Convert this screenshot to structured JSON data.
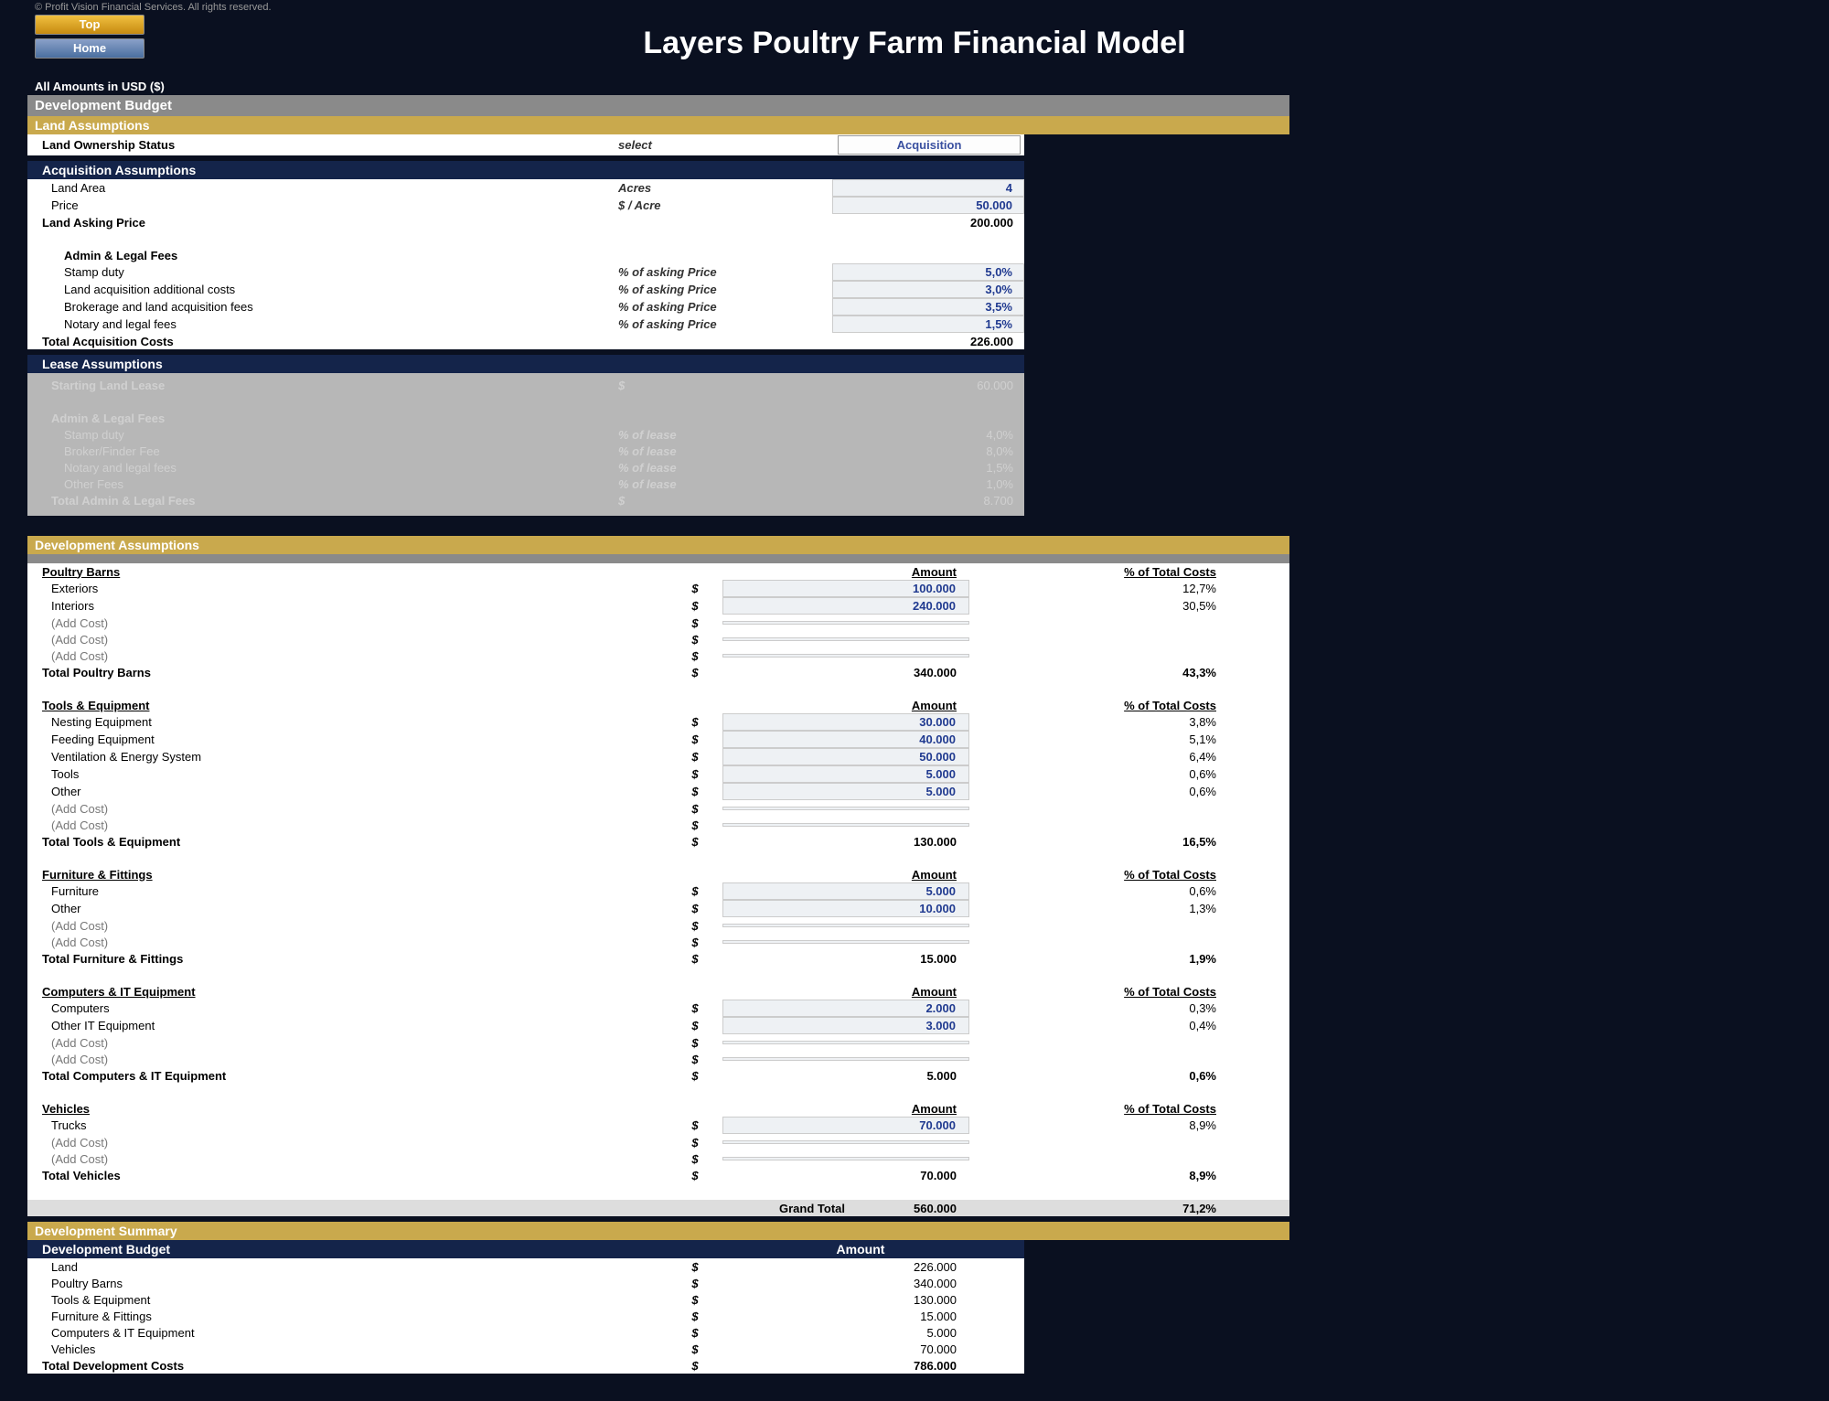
{
  "copyright": "© Profit Vision Financial Services. All rights reserved.",
  "buttons": {
    "top": "Top",
    "home": "Home"
  },
  "title": "Layers Poultry Farm Financial Model",
  "currency_note": "All Amounts in  USD ($)",
  "headers": {
    "development_budget": "Development Budget",
    "land_assumptions": "Land Assumptions",
    "acquisition_assumptions": "Acquisition Assumptions",
    "lease_assumptions": "Lease Assumptions",
    "development_assumptions": "Development Assumptions",
    "development_summary": "Development Summary",
    "development_budget2": "Development Budget"
  },
  "land_ownership": {
    "label": "Land Ownership Status",
    "unit": "select",
    "value": "Acquisition"
  },
  "acq": {
    "area": {
      "label": "Land Area",
      "unit": "Acres",
      "value": "4"
    },
    "price": {
      "label": "Price",
      "unit": "$ / Acre",
      "value": "50.000"
    },
    "asking": {
      "label": "Land Asking Price",
      "value": "200.000"
    },
    "fees_header": "Admin & Legal Fees",
    "fees": [
      {
        "label": "Stamp duty",
        "unit": "% of asking Price",
        "value": "5,0%"
      },
      {
        "label": "Land acquisition additional costs",
        "unit": "% of asking Price",
        "value": "3,0%"
      },
      {
        "label": "Brokerage and land acquisition fees",
        "unit": "% of asking Price",
        "value": "3,5%"
      },
      {
        "label": "Notary and legal fees",
        "unit": "% of asking Price",
        "value": "1,5%"
      }
    ],
    "total": {
      "label": "Total Acquisition Costs",
      "value": "226.000"
    }
  },
  "lease": {
    "start": {
      "label": "Starting Land Lease",
      "unit": "$",
      "value": "60.000"
    },
    "fees_header": "Admin & Legal Fees",
    "fees": [
      {
        "label": "Stamp duty",
        "unit": "% of lease",
        "value": "4,0%"
      },
      {
        "label": "Broker/Finder Fee",
        "unit": "% of lease",
        "value": "8,0%"
      },
      {
        "label": "Notary and legal fees",
        "unit": "% of lease",
        "value": "1,5%"
      },
      {
        "label": "Other Fees",
        "unit": "% of lease",
        "value": "1,0%"
      }
    ],
    "total": {
      "label": "Total Admin & Legal Fees",
      "unit": "$",
      "value": "8.700"
    }
  },
  "col_labels": {
    "amount": "Amount",
    "pct": "% of Total Costs",
    "grand_total": "Grand Total"
  },
  "dev": {
    "groups": [
      {
        "name": "Poultry Barns",
        "rows": [
          {
            "label": "Exteriors",
            "amt": "100.000",
            "pct": "12,7%"
          },
          {
            "label": "Interiors",
            "amt": "240.000",
            "pct": "30,5%"
          },
          {
            "label": "(Add Cost)",
            "amt": "",
            "pct": ""
          },
          {
            "label": "(Add Cost)",
            "amt": "",
            "pct": ""
          },
          {
            "label": "(Add Cost)",
            "amt": "",
            "pct": ""
          }
        ],
        "total": {
          "label": "Total Poultry Barns",
          "amt": "340.000",
          "pct": "43,3%"
        }
      },
      {
        "name": "Tools & Equipment",
        "rows": [
          {
            "label": "Nesting Equipment",
            "amt": "30.000",
            "pct": "3,8%"
          },
          {
            "label": "Feeding Equipment",
            "amt": "40.000",
            "pct": "5,1%"
          },
          {
            "label": "Ventilation & Energy System",
            "amt": "50.000",
            "pct": "6,4%"
          },
          {
            "label": "Tools",
            "amt": "5.000",
            "pct": "0,6%"
          },
          {
            "label": "Other",
            "amt": "5.000",
            "pct": "0,6%"
          },
          {
            "label": "(Add Cost)",
            "amt": "",
            "pct": ""
          },
          {
            "label": "(Add Cost)",
            "amt": "",
            "pct": ""
          }
        ],
        "total": {
          "label": "Total Tools & Equipment",
          "amt": "130.000",
          "pct": "16,5%"
        }
      },
      {
        "name": "Furniture & Fittings",
        "rows": [
          {
            "label": "Furniture",
            "amt": "5.000",
            "pct": "0,6%"
          },
          {
            "label": "Other",
            "amt": "10.000",
            "pct": "1,3%"
          },
          {
            "label": "(Add Cost)",
            "amt": "",
            "pct": ""
          },
          {
            "label": "(Add Cost)",
            "amt": "",
            "pct": ""
          }
        ],
        "total": {
          "label": "Total Furniture & Fittings",
          "amt": "15.000",
          "pct": "1,9%"
        }
      },
      {
        "name": "Computers & IT Equipment",
        "rows": [
          {
            "label": "Computers",
            "amt": "2.000",
            "pct": "0,3%"
          },
          {
            "label": "Other IT Equipment",
            "amt": "3.000",
            "pct": "0,4%"
          },
          {
            "label": "(Add Cost)",
            "amt": "",
            "pct": ""
          },
          {
            "label": "(Add Cost)",
            "amt": "",
            "pct": ""
          }
        ],
        "total": {
          "label": "Total Computers & IT Equipment",
          "amt": "5.000",
          "pct": "0,6%"
        }
      },
      {
        "name": "Vehicles",
        "rows": [
          {
            "label": "Trucks",
            "amt": "70.000",
            "pct": "8,9%"
          },
          {
            "label": "(Add Cost)",
            "amt": "",
            "pct": ""
          },
          {
            "label": "(Add Cost)",
            "amt": "",
            "pct": ""
          }
        ],
        "total": {
          "label": "Total Vehicles",
          "amt": "70.000",
          "pct": "8,9%"
        }
      }
    ],
    "grand_total": {
      "amt": "560.000",
      "pct": "71,2%"
    }
  },
  "summary": {
    "rows": [
      {
        "label": "Land",
        "amt": "226.000"
      },
      {
        "label": "Poultry Barns",
        "amt": "340.000"
      },
      {
        "label": "Tools & Equipment",
        "amt": "130.000"
      },
      {
        "label": "Furniture & Fittings",
        "amt": "15.000"
      },
      {
        "label": "Computers & IT Equipment",
        "amt": "5.000"
      },
      {
        "label": "Vehicles",
        "amt": "70.000"
      }
    ],
    "total": {
      "label": "Total Development Costs",
      "amt": "786.000"
    }
  }
}
